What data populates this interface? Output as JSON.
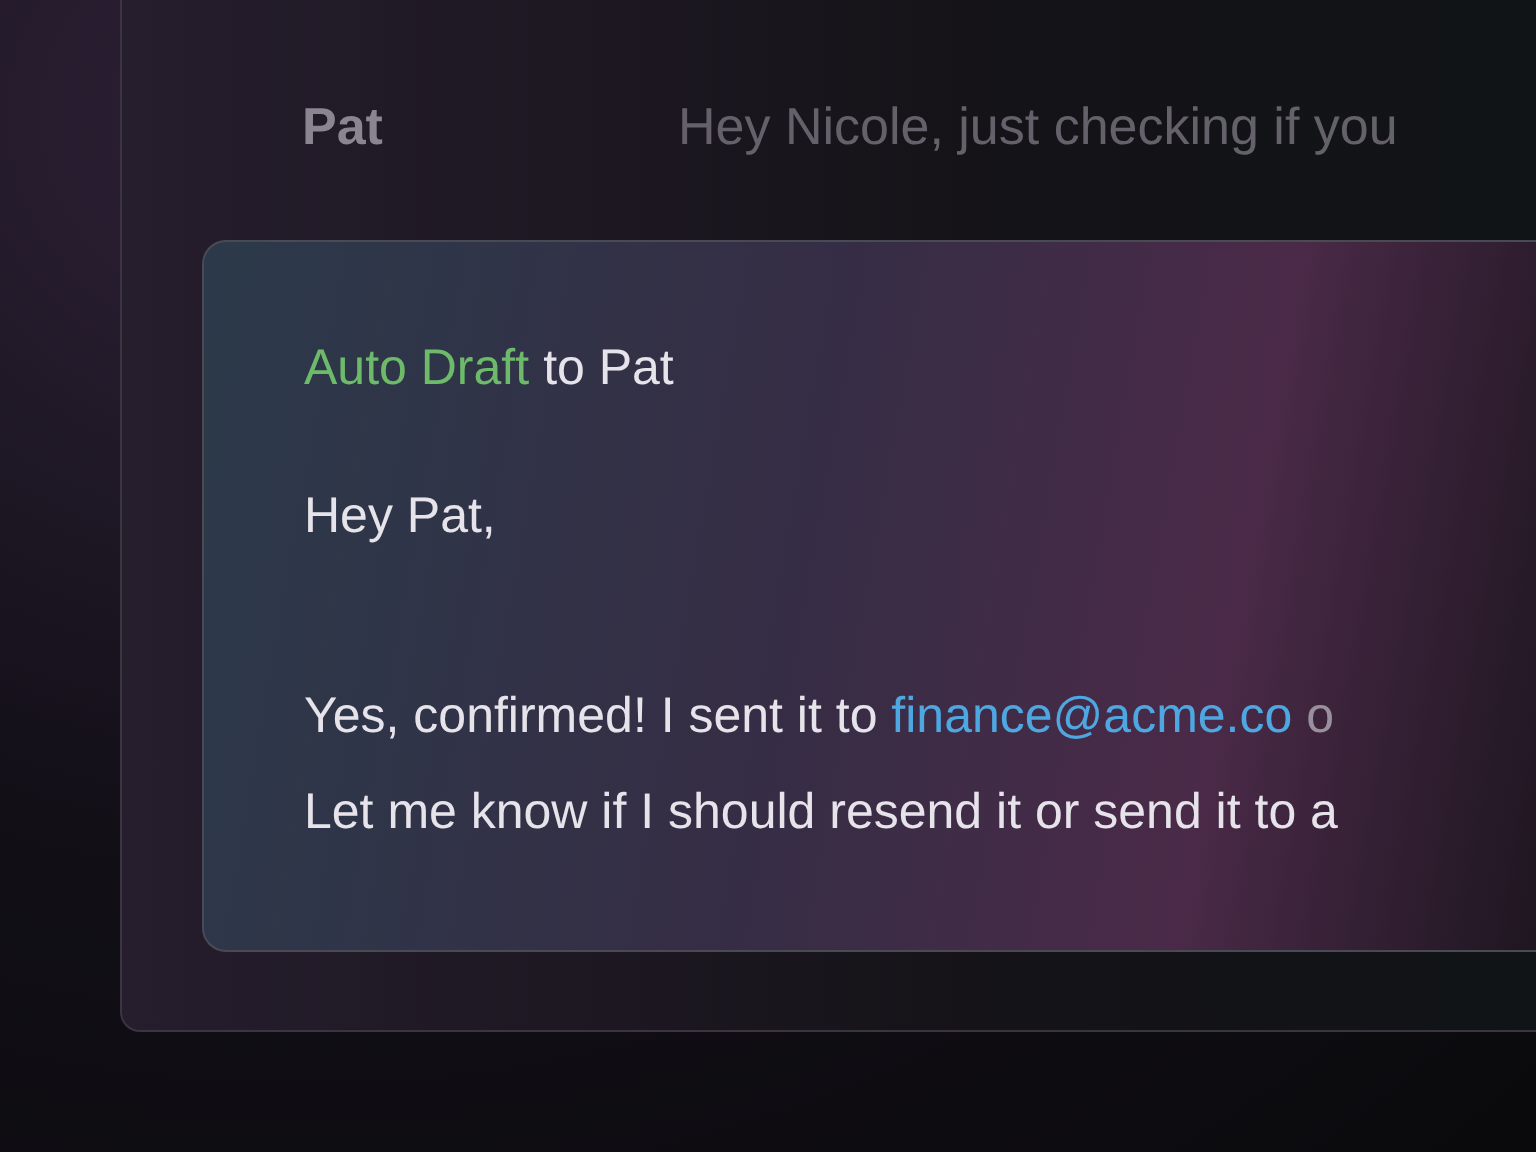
{
  "message_row": {
    "sender": "Pat",
    "preview": "Hey Nicole, just checking if you"
  },
  "draft": {
    "label": "Auto Draft",
    "recipient": "to Pat",
    "greeting": "Hey Pat,",
    "line_1": "Yes, confirmed! I sent it to",
    "link": "finance@acme.co",
    "line_1_tail": "o",
    "line_2": "Let me know if I should resend it or send it to a"
  }
}
